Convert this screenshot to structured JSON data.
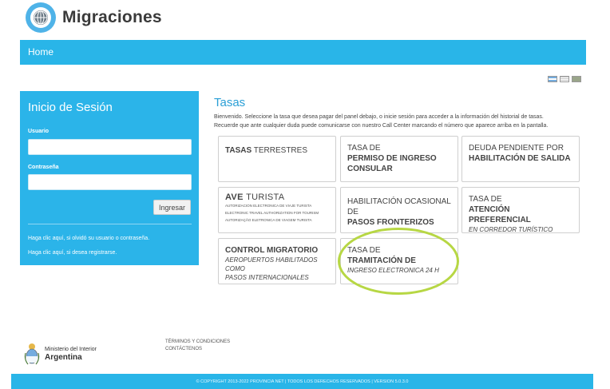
{
  "header": {
    "brand": "Migraciones"
  },
  "nav": {
    "home": "Home"
  },
  "login": {
    "title": "Inicio de Sesión",
    "user_label": "Usuario",
    "password_label": "Contraseña",
    "submit": "Ingresar",
    "forgot_link": "Haga clic aquí, si olvidó su usuario o contraseña.",
    "register_link": "Haga clic aquí, si desea registrarse."
  },
  "tasas": {
    "title": "Tasas",
    "desc1": "Bienvenido. Seleccione la tasa que desea pagar del panel debajo, o inicie sesión para acceder a la información del historial de tasas.",
    "desc2": "Recuerde que ante cualquier duda puede comunicarse con nuestro Call Center marcando el número que aparece arriba en la pantalla.",
    "cards": [
      {
        "bold": "TASAS",
        "normal": "TERRESTRES"
      },
      {
        "line1": "TASA DE",
        "line2": "PERMISO DE INGRESO",
        "line3": "CONSULAR"
      },
      {
        "line1": "DEUDA PENDIENTE POR",
        "line2": "HABILITACIÓN DE SALIDA"
      },
      {
        "logo_bold": "AVE",
        "logo_normal": "TURISTA",
        "t1": "AUTORIZACION ELECTRONICA DE VIAJE TURISTA",
        "t2": "ELECTRONIC TRAVEL AUTHORIZATION FOR TOURISM",
        "t3": "AUTORIZAÇÃO ELETRONICA DE VIAGEM TURISTA"
      },
      {
        "line1": "HABILITACIÓN OCASIONAL DE",
        "line2": "PASOS FRONTERIZOS"
      },
      {
        "line1": "TASA DE",
        "line2": "ATENCIÓN PREFERENCIAL",
        "line3": "EN CORREDOR TURÍSTICO"
      },
      {
        "line1": "CONTROL MIGRATORIO",
        "line2": "AEROPUERTOS HABILITADOS COMO",
        "line3": "PASOS INTERNACIONALES"
      },
      {
        "line1": "TASA DE",
        "line2": "TRAMITACIÓN DE",
        "line3": "INGRESO ELECTRONICA 24 H"
      }
    ]
  },
  "footer": {
    "ministry": "Ministerio del Interior",
    "country": "Argentina",
    "terms": "TÉRMINOS Y CONDICIONES",
    "contact": "CONTÁCTENOS",
    "copyright": "© COPYRIGHT 2013-2022 PROVINCIA NET | TODOS LOS DERECHOS RESERVADOS | VERSION 5.0.3.0"
  },
  "colors": {
    "brand_blue": "#29b5e8",
    "highlight": "#b7d744"
  },
  "icons": {
    "logo": "globe-logo-icon",
    "flags": [
      "flag-argentina-icon",
      "flag-english-icon",
      "flag-brazil-icon"
    ],
    "shield": "argentina-shield-icon"
  }
}
